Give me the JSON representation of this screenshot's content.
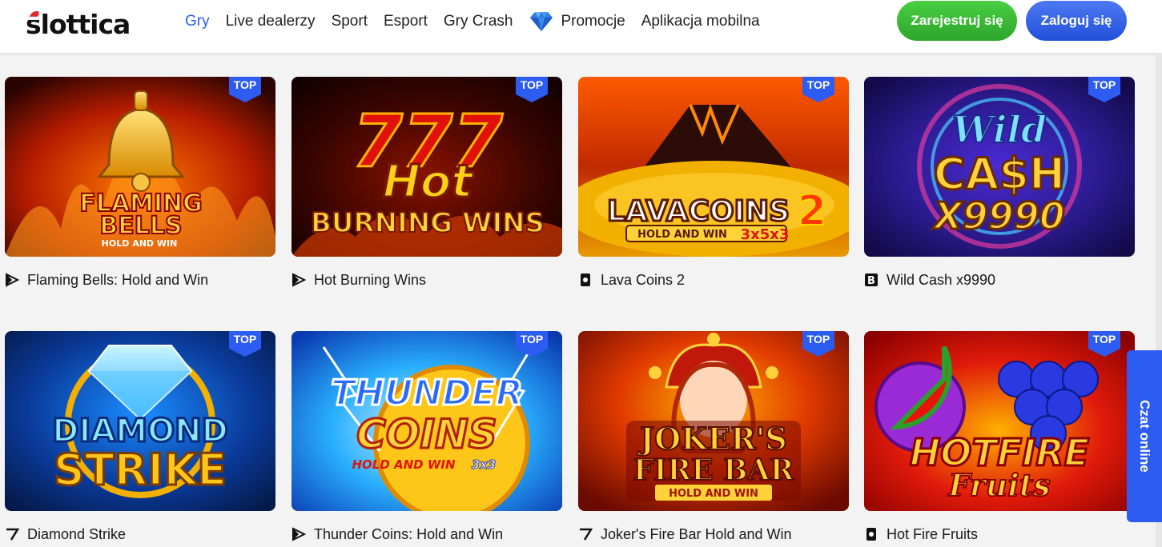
{
  "brand": {
    "logo_text": "slottica",
    "accent": "#2d5cf2",
    "register_green": "#3bbc36"
  },
  "nav": {
    "items": [
      {
        "label": "Gry",
        "active": true
      },
      {
        "label": "Live dealerzy",
        "active": false
      },
      {
        "label": "Sport",
        "active": false
      },
      {
        "label": "Esport",
        "active": false
      },
      {
        "label": "Gry Crash",
        "active": false
      },
      {
        "label": "Promocje",
        "active": false,
        "icon": "diamond-icon"
      },
      {
        "label": "Aplikacja mobilna",
        "active": false
      }
    ]
  },
  "auth": {
    "register_label": "Zarejestruj się",
    "login_label": "Zaloguj się"
  },
  "badge_label": "TOP",
  "games": [
    {
      "title": "Flaming Bells: Hold and Win",
      "provider_icon": "play-triangle-icon",
      "art_lines": [
        "FLAMING",
        "BELLS",
        "HOLD AND WIN"
      ]
    },
    {
      "title": "Hot Burning Wins",
      "provider_icon": "play-triangle-icon",
      "art_lines": [
        "777",
        "Hot",
        "BURNING WINS"
      ]
    },
    {
      "title": "Lava Coins 2",
      "provider_icon": "card-icon",
      "art_lines": [
        "LAVACOINS",
        "2",
        "HOLD AND WIN",
        "3x5x3"
      ]
    },
    {
      "title": "Wild Cash x9990",
      "provider_icon": "b-letter-icon",
      "art_lines": [
        "Wild",
        "CA$H",
        "X9990"
      ]
    },
    {
      "title": "Diamond Strike",
      "provider_icon": "seven-icon",
      "art_lines": [
        "DIAMOND",
        "STRIKE"
      ]
    },
    {
      "title": "Thunder Coins: Hold and Win",
      "provider_icon": "play-triangle-icon",
      "art_lines": [
        "THUNDER",
        "COINS",
        "HOLD AND WIN",
        "3x3"
      ]
    },
    {
      "title": "Joker's Fire Bar Hold and Win",
      "provider_icon": "seven-icon",
      "art_lines": [
        "JOKER'S",
        "FIRE BAR",
        "HOLD AND WIN"
      ]
    },
    {
      "title": "Hot Fire Fruits",
      "provider_icon": "card-icon",
      "art_lines": [
        "HOTFIRE",
        "Fruits"
      ]
    }
  ],
  "chat": {
    "label": "Czat online"
  }
}
